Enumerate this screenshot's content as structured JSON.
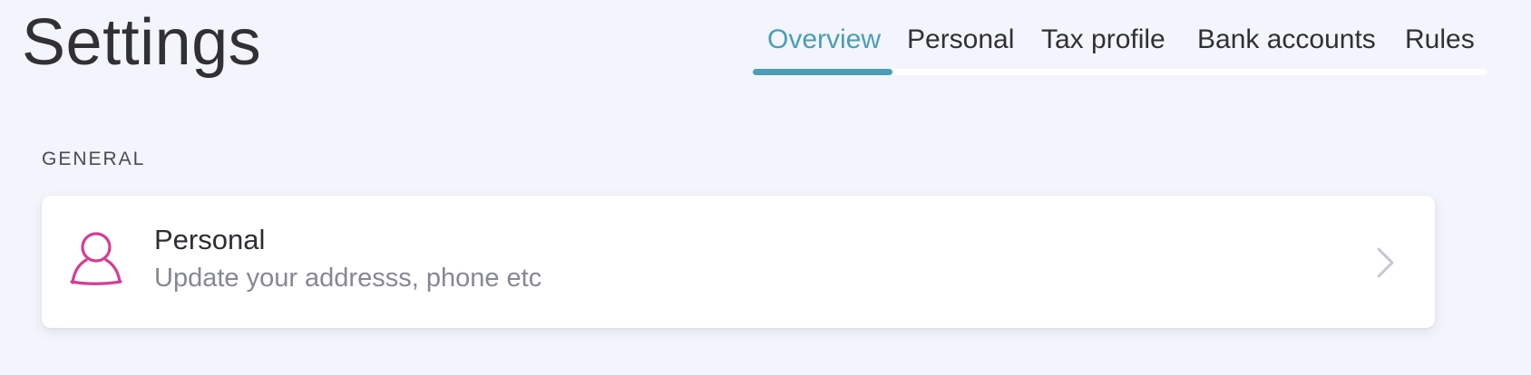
{
  "header": {
    "title": "Settings"
  },
  "tabs": [
    {
      "label": "Overview",
      "active": true
    },
    {
      "label": "Personal",
      "active": false
    },
    {
      "label": "Tax profile",
      "active": false
    },
    {
      "label": "Bank accounts",
      "active": false
    },
    {
      "label": "Rules",
      "active": false
    }
  ],
  "sections": [
    {
      "heading": "GENERAL",
      "cards": [
        {
          "icon": "user-icon",
          "title": "Personal",
          "subtitle": "Update your addresss, phone etc",
          "action_icon": "chevron-right-icon"
        }
      ]
    }
  ],
  "colors": {
    "background": "#f3f4fc",
    "accent": "#4a9eb5",
    "icon_accent": "#d63c93",
    "card": "#ffffff",
    "muted_text": "#868892"
  }
}
